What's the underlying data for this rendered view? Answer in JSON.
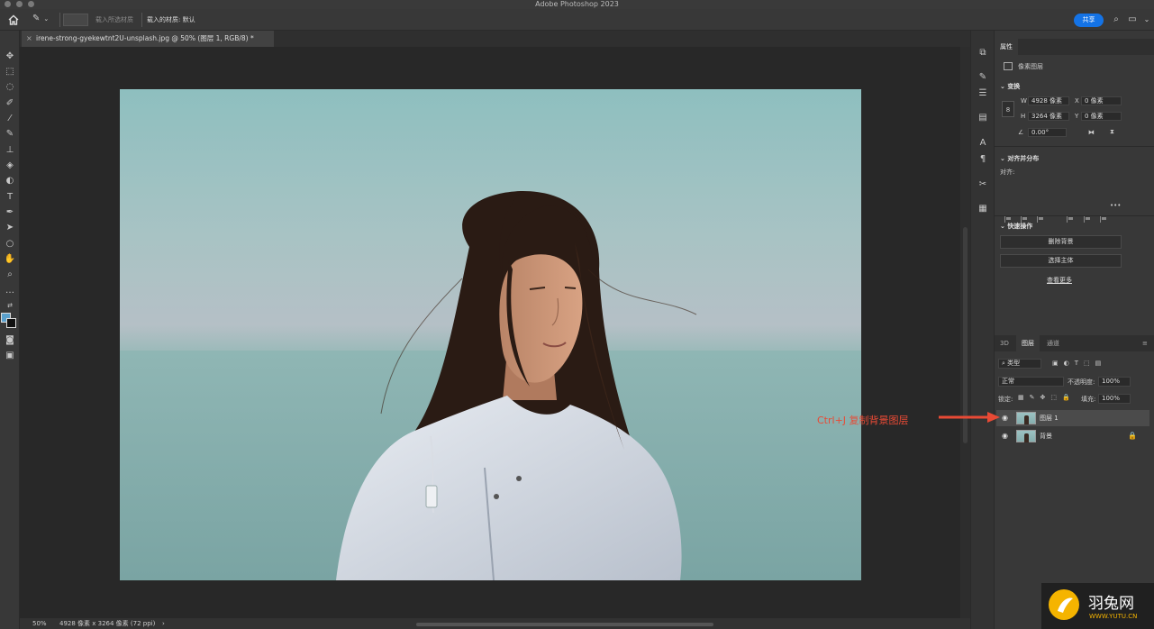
{
  "app": {
    "title": "Adobe Photoshop 2023"
  },
  "options_bar": {
    "load_selected_material": "载入所选材质",
    "loaded_material": "载入的材质: 默认",
    "share_label": "共享"
  },
  "document": {
    "tab_title": "irene-strong-gyekewtnt2U-unsplash.jpg @ 50% (图层 1, RGB/8) *",
    "close_glyph": "×"
  },
  "status_bar": {
    "zoom": "50%",
    "info": "4928 像素 x 3264 像素 (72 ppi)",
    "arrow": "›"
  },
  "colors": {
    "foreground": "#5aa0cc",
    "background": "#111111",
    "accent": "#1473e6",
    "annotation": "#e84a35"
  },
  "properties": {
    "tab": "属性",
    "layer_type": "像素图层",
    "transform_title": "变换",
    "w_label": "W",
    "w_value": "4928 像素",
    "h_label": "H",
    "h_value": "3264 像素",
    "x_label": "X",
    "x_value": "0 像素",
    "y_label": "Y",
    "y_value": "0 像素",
    "angle_value": "0.00°",
    "align_title": "对齐并分布",
    "align_label": "对齐:",
    "more": "•••",
    "quick_actions_title": "快速操作",
    "remove_bg": "删除背景",
    "select_subject": "选择主体",
    "view_more": "查看更多"
  },
  "layers_panel": {
    "tabs": [
      "3D",
      "图层",
      "通道"
    ],
    "active_tab": "图层",
    "filter_kind": "类型",
    "blend_mode": "正常",
    "opacity_label": "不透明度:",
    "opacity_value": "100%",
    "lock_label": "锁定:",
    "fill_label": "填充:",
    "fill_value": "100%",
    "layers": [
      {
        "name": "图层 1",
        "selected": true,
        "locked": false
      },
      {
        "name": "背景",
        "selected": false,
        "locked": true
      }
    ]
  },
  "annotation": {
    "text": "Ctrl+J 复制背景图层"
  },
  "watermark": {
    "name_cn": "羽兔网",
    "url": "WWW.YUTU.CN"
  }
}
